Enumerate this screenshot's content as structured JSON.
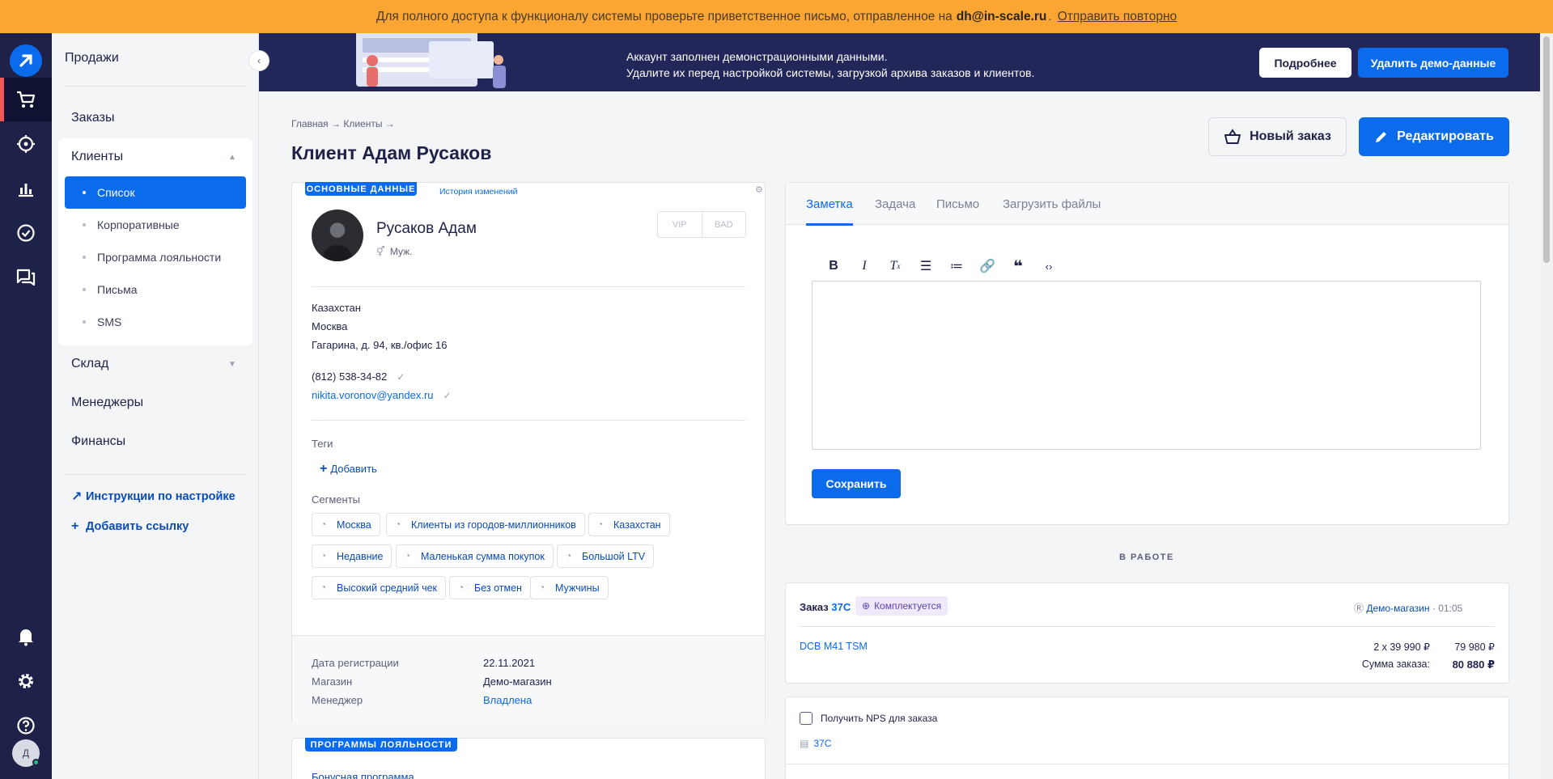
{
  "notice": {
    "text": "Для полного доступа к функционалу системы проверьте приветственное письмо, отправленное на",
    "email": "dh@in-scale.ru",
    "resend": "Отправить повторно"
  },
  "rail": {
    "logo_icon": "retailcrm-logo-icon",
    "items": [
      "cart-icon",
      "target-icon",
      "chart-icon",
      "check-circle-icon",
      "chat-icon"
    ],
    "bottom": [
      "bell-icon",
      "gear-icon",
      "help-icon"
    ],
    "avatar_initial": "Д"
  },
  "nav": {
    "section": "Продажи",
    "orders": "Заказы",
    "clients": "Клиенты",
    "clients_sub": [
      "Список",
      "Корпоративные",
      "Программа лояльности",
      "Письма",
      "SMS"
    ],
    "warehouse": "Склад",
    "managers": "Менеджеры",
    "finance": "Финансы",
    "setup_link": "Инструкции по настройке",
    "add_link": "Добавить ссылку"
  },
  "banner": {
    "line1": "Аккаунт заполнен демонстрационными данными.",
    "line2": "Удалите их перед настройкой системы, загрузкой архива заказов и клиентов.",
    "more": "Подробнее",
    "delete": "Удалить демо-данные"
  },
  "header": {
    "breadcrumb": "Главная → Клиенты →",
    "title": "Клиент Адам Русаков",
    "new_order": "Новый заказ",
    "edit": "Редактировать"
  },
  "client": {
    "section_tag": "ОСНОВНЫЕ ДАННЫЕ",
    "history": "История изменений",
    "name": "Русаков Адам",
    "gender": "Муж.",
    "vip": "VIP",
    "bad": "BAD",
    "country": "Казахстан",
    "city": "Москва",
    "address": "Гагарина, д. 94, кв./офис 16",
    "phone": "(812) 538-34-82",
    "email": "nikita.voronov@yandex.ru",
    "tags_label": "Теги",
    "add_tag": "Добавить",
    "segments_label": "Сегменты",
    "segments": [
      "Москва",
      "Клиенты из городов-миллионников",
      "Казахстан",
      "Недавние",
      "Маленькая сумма покупок",
      "Большой LTV",
      "Высокий средний чек",
      "Без отмен",
      "Мужчины"
    ],
    "reg_label": "Дата регистрации",
    "reg_value": "22.11.2021",
    "shop_label": "Магазин",
    "shop_value": "Демо-магазин",
    "manager_label": "Менеджер",
    "manager_value": "Владлена"
  },
  "loyalty": {
    "section_tag": "ПРОГРАММЫ ЛОЯЛЬНОСТИ",
    "item": "Бонусная программа"
  },
  "note": {
    "tabs": [
      "Заметка",
      "Задача",
      "Письмо",
      "Загрузить файлы"
    ],
    "save": "Сохранить"
  },
  "work": {
    "title": "В РАБОТЕ",
    "order_prefix": "Заказ",
    "order_num": "37С",
    "status": "Комплектуется",
    "shop": "Демо-магазин",
    "time": "01:05",
    "product": "DCB M41 TSM",
    "qty": "2 x 39 990 ₽",
    "line_total": "79 980 ₽",
    "sum_label": "Сумма заказа:",
    "sum_value": "80 880 ₽",
    "nps": "Получить NPS для заказа",
    "nps_order": "37С"
  }
}
